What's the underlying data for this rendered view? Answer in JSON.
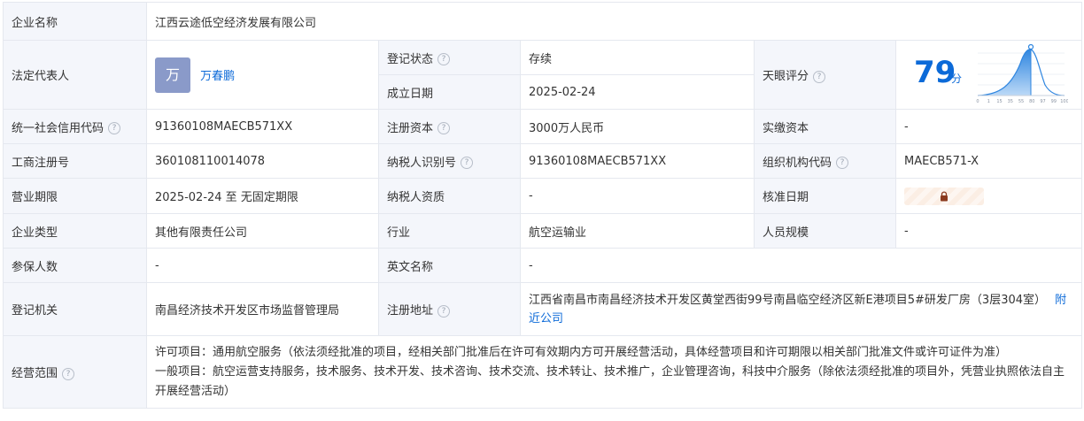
{
  "labels": {
    "company_name": "企业名称",
    "legal_rep": "法定代表人",
    "reg_status": "登记状态",
    "est_date": "成立日期",
    "tianyan_score": "天眼评分",
    "credit_code": "统一社会信用代码",
    "reg_capital": "注册资本",
    "paid_capital": "实缴资本",
    "biz_reg_no": "工商注册号",
    "taxpayer_id": "纳税人识别号",
    "org_code": "组织机构代码",
    "biz_term": "营业期限",
    "taxpayer_qual": "纳税人资质",
    "approval_date": "核准日期",
    "company_type": "企业类型",
    "industry": "行业",
    "staff_size": "人员规模",
    "insured_count": "参保人数",
    "english_name": "英文名称",
    "reg_authority": "登记机关",
    "reg_address": "注册地址",
    "biz_scope": "经营范围"
  },
  "values": {
    "company_name": "江西云途低空经济发展有限公司",
    "legal_rep_avatar": "万",
    "legal_rep": "万春鹏",
    "reg_status": "存续",
    "est_date": "2025-02-24",
    "score": "79",
    "score_unit": "分",
    "credit_code": "91360108MAECB571XX",
    "reg_capital": "3000万人民币",
    "paid_capital": "-",
    "biz_reg_no": "360108110014078",
    "taxpayer_id": "91360108MAECB571XX",
    "org_code": "MAECB571-X",
    "biz_term": "2025-02-24 至 无固定期限",
    "taxpayer_qual": "-",
    "company_type": "其他有限责任公司",
    "industry": "航空运输业",
    "staff_size": "-",
    "insured_count": "-",
    "english_name": "-",
    "reg_authority": "南昌经济技术开发区市场监督管理局",
    "reg_address": "江西省南昌市南昌经济技术开发区黄堂西街99号南昌临空经济区新E港项目5#研发厂房（3层304室）",
    "nearby_link": "附近公司",
    "biz_scope_1": "许可项目：通用航空服务（依法须经批准的项目，经相关部门批准后在许可有效期内方可开展经营活动，具体经营项目和许可期限以相关部门批准文件或许可证件为准）",
    "biz_scope_2": "一般项目：航空运营支持服务，技术服务、技术开发、技术咨询、技术交流、技术转让、技术推广，企业管理咨询，科技中介服务（除依法须经批准的项目外，凭营业执照依法自主开展经营活动）"
  },
  "score_chart": {
    "ticks": [
      "0",
      "1",
      "15",
      "35",
      "55",
      "80",
      "97",
      "99",
      "100"
    ],
    "marker_value": 79
  },
  "icons": {
    "help": "question-circle-icon",
    "lock": "lock-icon"
  },
  "colors": {
    "label_bg": "#f4f6fb",
    "border": "#e5e8ef",
    "link": "#0c6ad8",
    "status": "#16a34a",
    "score": "#0c6ad8"
  }
}
